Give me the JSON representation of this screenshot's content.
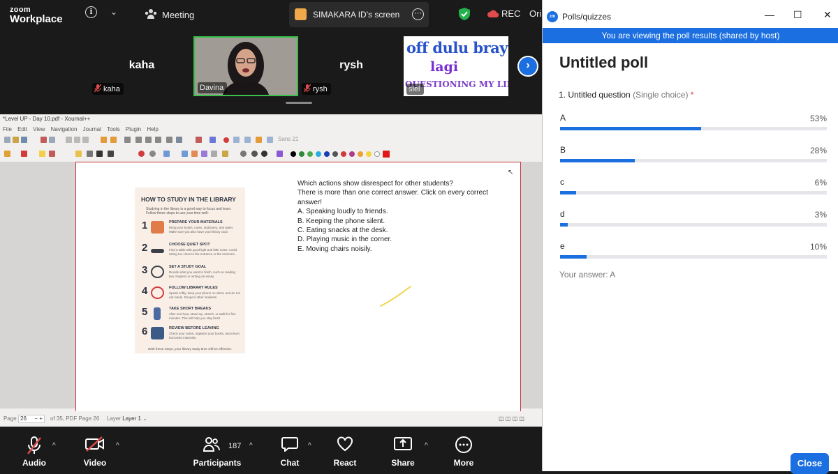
{
  "topbar": {
    "logo_line1": "zoom",
    "logo_line2": "Workplace",
    "meeting_label": "Meeting",
    "share_label": "SIMAKARA ID's screen",
    "rec_label": "REC",
    "orig_label": "Ori"
  },
  "participants": [
    {
      "name": "kaha",
      "tag": "kaha",
      "muted": true
    },
    {
      "name": "Davina",
      "tag": "Davina",
      "muted": false
    },
    {
      "name": "rysh",
      "tag": "rysh",
      "muted": true
    },
    {
      "name": "siel",
      "tag": "siel",
      "muted": false
    }
  ],
  "siel_tile": {
    "line1": "off dulu bray",
    "line2": "lagi",
    "line3": "QUESTIONING MY LIFE"
  },
  "xournal": {
    "window_title": "*Level UP - Day 10.pdf - Xournal++",
    "menu": [
      "File",
      "Edit",
      "View",
      "Navigation",
      "Journal",
      "Tools",
      "Plugin",
      "Help"
    ],
    "sans_label": "Sans",
    "sans_size": "21",
    "status": {
      "page_label": "Page",
      "page_value": "26",
      "of_text": "of 35, PDF Page 26",
      "layer_label": "Layer",
      "layer_value": "Layer 1"
    }
  },
  "infographic": {
    "title": "HOW TO STUDY IN THE LIBRARY",
    "intro": "Studying in the library is a good way to focus and learn. Follow these steps to use your time well:",
    "steps": [
      {
        "num": "1",
        "heading": "PREPARE YOUR MATERIALS",
        "text": "Bring your books, notes, stationery, and water. Make sure you also have your library card."
      },
      {
        "num": "2",
        "heading": "CHOOSE QUIET SPOT",
        "text": "Find a table with good light and little noise. Avoid sitting too close to the entrance or the restroom."
      },
      {
        "num": "3",
        "heading": "SET A STUDY GOAL",
        "text": "Decide what you want to finish, such as reading two chapters or writing an essay"
      },
      {
        "num": "4",
        "heading": "FOLLOW LIBRARY RULES",
        "text": "Speak softly, keep your phone on silent, and do not eat inside. Respect other students."
      },
      {
        "num": "5",
        "heading": "TAKE SHORT BREAKS",
        "text": "After one hour, stand up, stretch, or walk for five minutes. This will help you stay fresh"
      },
      {
        "num": "6",
        "heading": "REVIEW BEFORE LEAVING",
        "text": "Check your notes, organize your books, and return borrowed materials."
      }
    ],
    "footer": "With these steps, your library study time will be effective."
  },
  "quiz": {
    "question": "Which actions show disrespect for other students?",
    "instruction": "There is more than one correct answer. Click on every correct answer!",
    "options": [
      "A. Speaking loudly to friends.",
      "B. Keeping the phone silent.",
      "C. Eating snacks at the desk.",
      "D. Playing music in the corner.",
      "E. Moving chairs noisily."
    ]
  },
  "toolbar": {
    "audio": "Audio",
    "video": "Video",
    "participants": "Participants",
    "participant_count": "187",
    "chat": "Chat",
    "react": "React",
    "share": "Share",
    "more": "More"
  },
  "poll_panel": {
    "window_title": "Polls/quizzes",
    "banner": "You are viewing the poll results (shared by host)",
    "poll_title": "Untitled poll",
    "question": "1. Untitled question",
    "question_type": "(Single choice)",
    "required_mark": "*",
    "results": [
      {
        "label": "A",
        "percent_text": "53%",
        "percent": 53
      },
      {
        "label": "B",
        "percent_text": "28%",
        "percent": 28
      },
      {
        "label": "c",
        "percent_text": "6%",
        "percent": 6
      },
      {
        "label": "d",
        "percent_text": "3%",
        "percent": 3
      },
      {
        "label": "e",
        "percent_text": "10%",
        "percent": 10
      }
    ],
    "your_answer": "Your answer: A",
    "close_label": "Close",
    "accent_color": "#1b6fe0"
  }
}
